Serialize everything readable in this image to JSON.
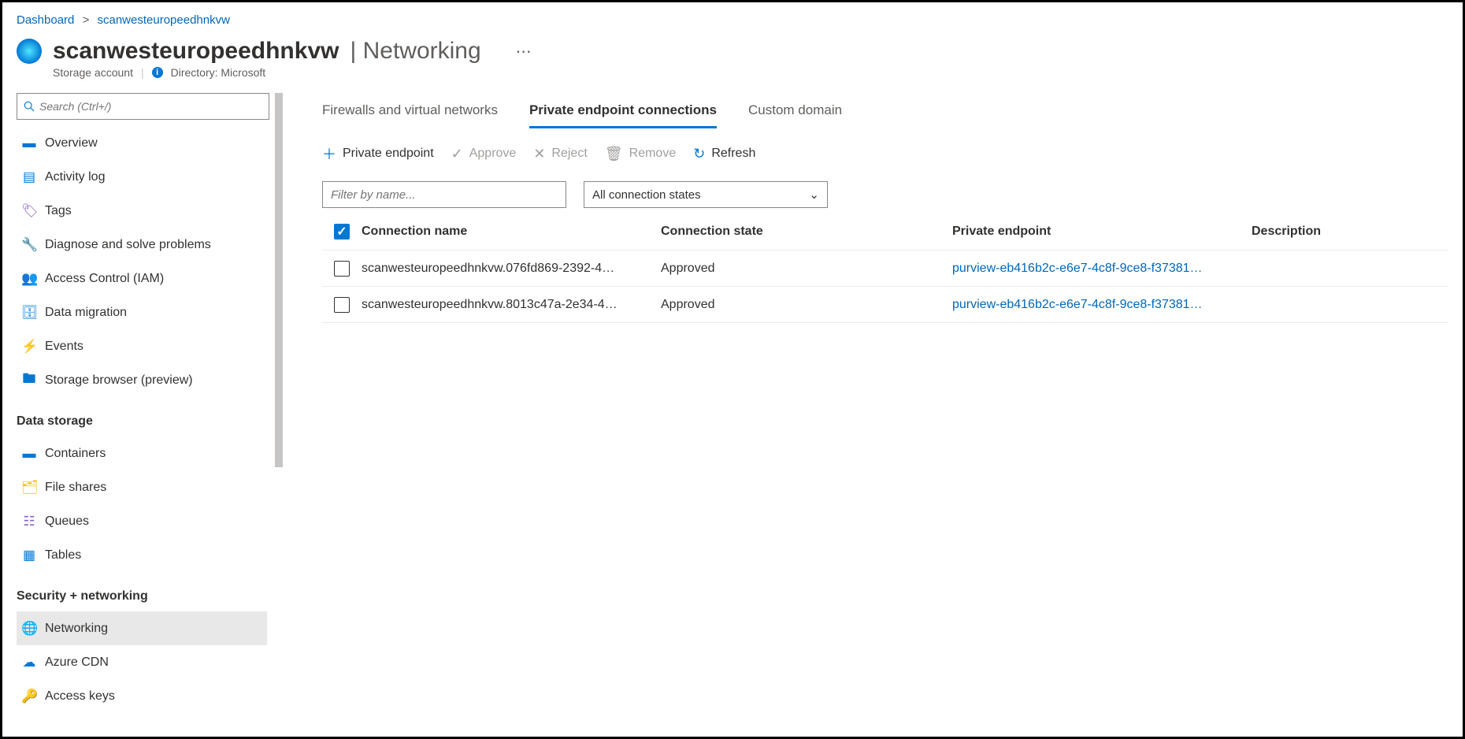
{
  "breadcrumb": {
    "root": "Dashboard",
    "current": "scanwesteuropeedhnkvw"
  },
  "header": {
    "resource_name": "scanwesteuropeedhnkvw",
    "blade_title": "Networking",
    "resource_type": "Storage account",
    "directory_label": "Directory: Microsoft"
  },
  "search": {
    "placeholder": "Search (Ctrl+/)"
  },
  "sidebar": {
    "items": [
      {
        "label": "Overview",
        "icon": "overview"
      },
      {
        "label": "Activity log",
        "icon": "activitylog"
      },
      {
        "label": "Tags",
        "icon": "tags"
      },
      {
        "label": "Diagnose and solve problems",
        "icon": "diagnose"
      },
      {
        "label": "Access Control (IAM)",
        "icon": "iam"
      },
      {
        "label": "Data migration",
        "icon": "migration"
      },
      {
        "label": "Events",
        "icon": "events"
      },
      {
        "label": "Storage browser (preview)",
        "icon": "browser"
      }
    ],
    "section_data_storage": "Data storage",
    "data_storage_items": [
      {
        "label": "Containers",
        "icon": "containers"
      },
      {
        "label": "File shares",
        "icon": "fileshares"
      },
      {
        "label": "Queues",
        "icon": "queues"
      },
      {
        "label": "Tables",
        "icon": "tables"
      }
    ],
    "section_security": "Security + networking",
    "security_items": [
      {
        "label": "Networking",
        "icon": "networking",
        "active": true
      },
      {
        "label": "Azure CDN",
        "icon": "cdn"
      },
      {
        "label": "Access keys",
        "icon": "keys"
      }
    ]
  },
  "tabs": {
    "firewalls": "Firewalls and virtual networks",
    "private": "Private endpoint connections",
    "custom": "Custom domain"
  },
  "toolbar": {
    "add": "Private endpoint",
    "approve": "Approve",
    "reject": "Reject",
    "remove": "Remove",
    "refresh": "Refresh"
  },
  "filters": {
    "name_placeholder": "Filter by name...",
    "state_label": "All connection states"
  },
  "table": {
    "headers": {
      "name": "Connection name",
      "state": "Connection state",
      "pe": "Private endpoint",
      "desc": "Description"
    },
    "rows": [
      {
        "name": "scanwesteuropeedhnkvw.076fd869-2392-4…",
        "state": "Approved",
        "pe": "purview-eb416b2c-e6e7-4c8f-9ce8-f37381…",
        "desc": ""
      },
      {
        "name": "scanwesteuropeedhnkvw.8013c47a-2e34-4…",
        "state": "Approved",
        "pe": "purview-eb416b2c-e6e7-4c8f-9ce8-f37381…",
        "desc": ""
      }
    ]
  }
}
